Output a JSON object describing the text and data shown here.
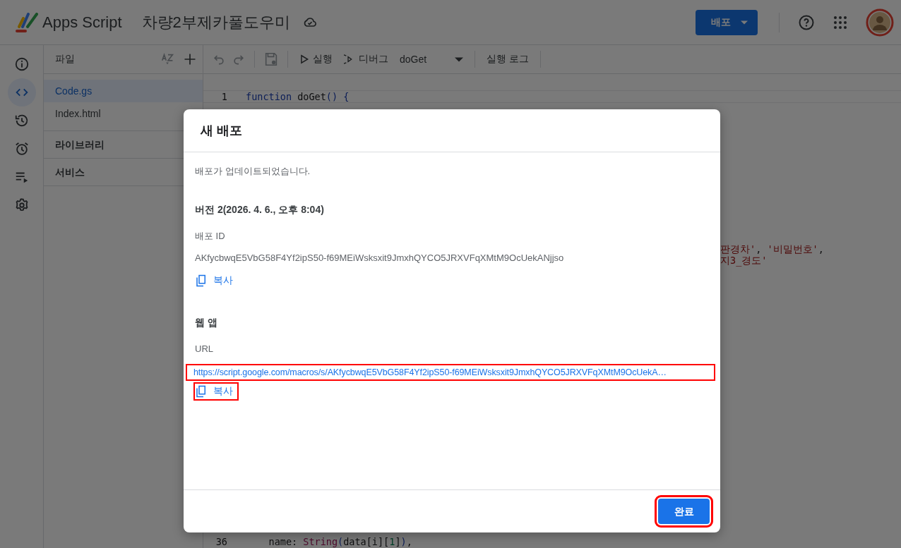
{
  "header": {
    "product": "Apps Script",
    "project_title": "차량2부제카풀도우미",
    "deploy_button": "배포"
  },
  "rail": [
    {
      "kind": "info",
      "selected": false
    },
    {
      "kind": "code",
      "selected": true
    },
    {
      "kind": "history",
      "selected": false
    },
    {
      "kind": "alarm",
      "selected": false
    },
    {
      "kind": "executions",
      "selected": false
    },
    {
      "kind": "settings",
      "selected": false
    }
  ],
  "files_panel": {
    "title": "파일",
    "files": [
      {
        "name": "Code.gs",
        "selected": true
      },
      {
        "name": "Index.html",
        "selected": false
      }
    ],
    "sections": [
      "라이브러리",
      "서비스"
    ]
  },
  "toolbar": {
    "run": "실행",
    "debug": "디버그",
    "function": "doGet",
    "log": "실행 로그"
  },
  "editor": {
    "lines": [
      {
        "number": "1",
        "tokens": [
          {
            "text": "function",
            "kind": "keyword"
          },
          {
            "text": " doGet",
            "kind": "plain"
          },
          {
            "text": "()",
            "kind": "paren"
          },
          {
            "text": " {",
            "kind": "paren"
          }
        ]
      }
    ],
    "fragments": [
      {
        "tokens": [
          {
            "text": "판경차'",
            "kind": "string"
          },
          {
            "text": ", ",
            "kind": "plain"
          },
          {
            "text": "'비밀번호'",
            "kind": "string"
          },
          {
            "text": ",",
            "kind": "plain"
          }
        ]
      },
      {
        "tokens": [
          {
            "text": "지3_경도'",
            "kind": "string"
          }
        ]
      }
    ],
    "bottom_line": {
      "number": "36",
      "tokens": [
        {
          "text": "    name: ",
          "kind": "plain"
        },
        {
          "text": "String",
          "kind": "builtin"
        },
        {
          "text": "(",
          "kind": "paren"
        },
        {
          "text": "data[i][",
          "kind": "plain"
        },
        {
          "text": "1",
          "kind": "number"
        },
        {
          "text": "]",
          "kind": "plain"
        },
        {
          "text": ")",
          "kind": "paren"
        },
        {
          "text": ",",
          "kind": "plain"
        }
      ]
    }
  },
  "dialog": {
    "title": "새 배포",
    "message": "배포가 업데이트되었습니다.",
    "version": "버전 2(2026. 4. 6., 오후 8:04)",
    "deployment_id_label": "배포 ID",
    "deployment_id": "AKfycbwqE5VbG58F4Yf2ipS50-f69MEiWsksxit9JmxhQYCO5JRXVFqXMtM9OcUekANjjso",
    "copy_id": {
      "label": "복사",
      "highlighted": false
    },
    "web_app_heading": "웹 앱",
    "url_label": "URL",
    "url": {
      "text": "https://script.google.com/macros/s/AKfycbwqE5VbG58F4Yf2ipS50-f69MEiWsksxit9JmxhQYCO5JRXVFqXMtM9OcUekA…",
      "highlighted": true
    },
    "copy_url": {
      "label": "복사",
      "highlighted": true
    },
    "done": {
      "label": "완료",
      "highlighted": true
    }
  }
}
